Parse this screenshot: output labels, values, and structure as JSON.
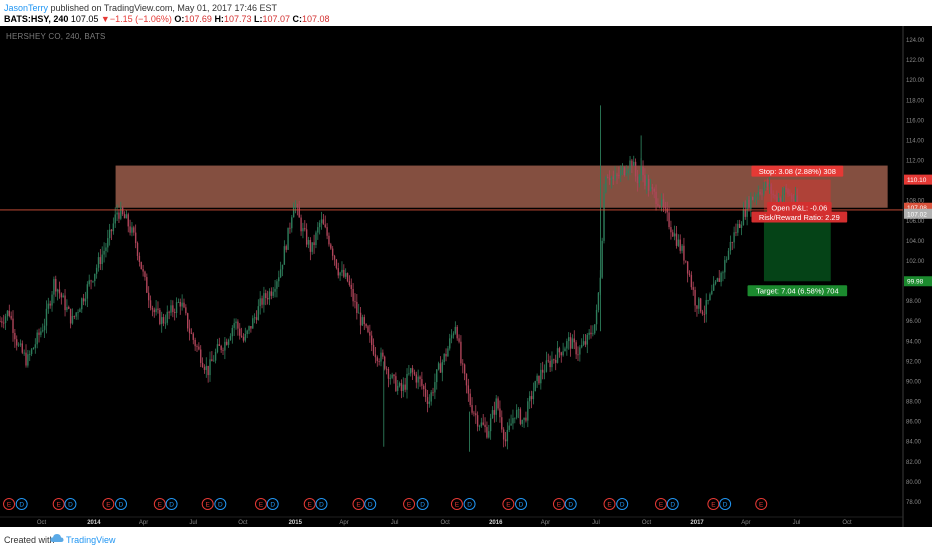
{
  "header": {
    "author": "JasonTerry",
    "published_text": " published on TradingView.com, May 01, 2017 17:46 EST",
    "symbol": "BATS:HSY, 240",
    "last": "107.05",
    "change": "▼−1.15 (−1.06%)",
    "open_label": "O:",
    "open": "107.69",
    "high_label": "H:",
    "high": "107.73",
    "low_label": "L:",
    "low": "107.07",
    "close_label": "C:",
    "close": "107.08"
  },
  "footer": {
    "created_with": "Created with",
    "brand": "TradingView"
  },
  "colors": {
    "background": "#000000",
    "up_candle": "#2e7d5b",
    "down_candle": "#b0455a",
    "resistance_zone": "#b06a55",
    "stop_zone": "#ff2b2b",
    "target_zone": "#0a7a2a",
    "earnings": "#e53935",
    "dividend": "#2196f3"
  },
  "chart_data": {
    "type": "candlestick",
    "title": "HERSHEY CO, 240, BATS",
    "y_ticks": [
      "124.00",
      "122.00",
      "120.00",
      "118.00",
      "116.00",
      "114.00",
      "112.00",
      "110.00",
      "108.00",
      "106.00",
      "104.00",
      "102.00",
      "100.00",
      "98.00",
      "96.00",
      "94.00",
      "92.00",
      "90.00",
      "88.00",
      "86.00",
      "84.00",
      "82.00",
      "80.00",
      "78.00"
    ],
    "ylim": [
      77,
      125
    ],
    "x_ticks": [
      {
        "label": "Oct",
        "pos": 0.046
      },
      {
        "label": "2014",
        "pos": 0.104,
        "bold": true
      },
      {
        "label": "Apr",
        "pos": 0.159
      },
      {
        "label": "Jul",
        "pos": 0.214
      },
      {
        "label": "Oct",
        "pos": 0.269
      },
      {
        "label": "2015",
        "pos": 0.327,
        "bold": true
      },
      {
        "label": "Apr",
        "pos": 0.381
      },
      {
        "label": "Jul",
        "pos": 0.437
      },
      {
        "label": "Oct",
        "pos": 0.493
      },
      {
        "label": "2016",
        "pos": 0.549,
        "bold": true
      },
      {
        "label": "Apr",
        "pos": 0.604
      },
      {
        "label": "Jul",
        "pos": 0.66
      },
      {
        "label": "Oct",
        "pos": 0.716
      },
      {
        "label": "2017",
        "pos": 0.772,
        "bold": true
      },
      {
        "label": "Apr",
        "pos": 0.826
      },
      {
        "label": "Jul",
        "pos": 0.882
      },
      {
        "label": "Oct",
        "pos": 0.938
      }
    ],
    "price_path": [
      [
        0,
        96
      ],
      [
        0.01,
        97
      ],
      [
        0.02,
        93.5
      ],
      [
        0.03,
        92
      ],
      [
        0.04,
        94
      ],
      [
        0.05,
        96
      ],
      [
        0.06,
        100
      ],
      [
        0.07,
        98
      ],
      [
        0.08,
        96
      ],
      [
        0.09,
        98
      ],
      [
        0.1,
        100
      ],
      [
        0.11,
        102
      ],
      [
        0.12,
        104
      ],
      [
        0.13,
        107
      ],
      [
        0.14,
        106
      ],
      [
        0.15,
        104
      ],
      [
        0.16,
        100
      ],
      [
        0.17,
        97
      ],
      [
        0.18,
        96
      ],
      [
        0.19,
        97
      ],
      [
        0.2,
        98
      ],
      [
        0.21,
        95
      ],
      [
        0.22,
        93
      ],
      [
        0.23,
        91
      ],
      [
        0.24,
        93
      ],
      [
        0.25,
        94
      ],
      [
        0.26,
        96
      ],
      [
        0.27,
        94
      ],
      [
        0.28,
        96
      ],
      [
        0.29,
        98
      ],
      [
        0.3,
        99
      ],
      [
        0.31,
        101
      ],
      [
        0.32,
        105
      ],
      [
        0.325,
        108
      ],
      [
        0.335,
        105
      ],
      [
        0.345,
        103
      ],
      [
        0.355,
        106
      ],
      [
        0.365,
        104
      ],
      [
        0.375,
        101
      ],
      [
        0.385,
        100
      ],
      [
        0.395,
        97
      ],
      [
        0.405,
        95
      ],
      [
        0.415,
        93
      ],
      [
        0.425,
        92
      ],
      [
        0.435,
        90
      ],
      [
        0.445,
        89
      ],
      [
        0.455,
        91
      ],
      [
        0.465,
        90
      ],
      [
        0.475,
        88
      ],
      [
        0.485,
        91
      ],
      [
        0.495,
        93
      ],
      [
        0.505,
        96
      ],
      [
        0.51,
        92
      ],
      [
        0.52,
        88
      ],
      [
        0.53,
        86
      ],
      [
        0.54,
        85
      ],
      [
        0.55,
        88
      ],
      [
        0.56,
        84
      ],
      [
        0.57,
        87
      ],
      [
        0.58,
        86
      ],
      [
        0.59,
        89
      ],
      [
        0.6,
        91
      ],
      [
        0.61,
        92
      ],
      [
        0.62,
        93
      ],
      [
        0.63,
        94
      ],
      [
        0.64,
        93
      ],
      [
        0.65,
        94
      ],
      [
        0.66,
        96
      ],
      [
        0.665,
        101
      ],
      [
        0.67,
        111
      ],
      [
        0.68,
        110
      ],
      [
        0.69,
        111
      ],
      [
        0.7,
        112
      ],
      [
        0.705,
        110
      ],
      [
        0.71,
        111
      ],
      [
        0.72,
        109
      ],
      [
        0.73,
        108
      ],
      [
        0.74,
        106
      ],
      [
        0.75,
        104
      ],
      [
        0.76,
        102
      ],
      [
        0.77,
        98
      ],
      [
        0.78,
        97
      ],
      [
        0.79,
        99
      ],
      [
        0.8,
        101
      ],
      [
        0.81,
        104
      ],
      [
        0.82,
        106
      ],
      [
        0.83,
        108
      ],
      [
        0.84,
        109
      ],
      [
        0.85,
        109.5
      ],
      [
        0.86,
        108
      ],
      [
        0.87,
        109
      ],
      [
        0.88,
        108
      ],
      [
        0.885,
        107.1
      ]
    ],
    "resistance_zone": {
      "price_top": 111.5,
      "price_bottom": 107.3,
      "x_start": 0.128,
      "x_end": 0.983
    },
    "price_line": 107.08,
    "position": {
      "entry": 107.02,
      "stop": 110.1,
      "target": 99.98,
      "x_start": 0.846,
      "x_end": 0.92,
      "stop_label": "Stop: 3.08 (2.88%) 308",
      "pnl_label": "Open P&L: -0.06",
      "rr_label": "Risk/Reward Ratio: 2.29",
      "target_label": "Target: 7.04 (6.58%) 704"
    },
    "price_tags": [
      {
        "text": "110.10",
        "price": 110.1,
        "color": "#e53935"
      },
      {
        "text": "107.08",
        "price": 107.3,
        "color": "#d9533c"
      },
      {
        "text": "107.02",
        "price": 106.7,
        "color": "#b0b0b0"
      },
      {
        "text": "99.98",
        "price": 99.98,
        "color": "#1b8a2e"
      }
    ],
    "event_markers": [
      {
        "type": "E",
        "pos": 0.01
      },
      {
        "type": "D",
        "pos": 0.024
      },
      {
        "type": "E",
        "pos": 0.065
      },
      {
        "type": "D",
        "pos": 0.078
      },
      {
        "type": "E",
        "pos": 0.12
      },
      {
        "type": "D",
        "pos": 0.134
      },
      {
        "type": "E",
        "pos": 0.177
      },
      {
        "type": "D",
        "pos": 0.19
      },
      {
        "type": "E",
        "pos": 0.23
      },
      {
        "type": "D",
        "pos": 0.244
      },
      {
        "type": "E",
        "pos": 0.289
      },
      {
        "type": "D",
        "pos": 0.302
      },
      {
        "type": "E",
        "pos": 0.343
      },
      {
        "type": "D",
        "pos": 0.356
      },
      {
        "type": "E",
        "pos": 0.397
      },
      {
        "type": "D",
        "pos": 0.41
      },
      {
        "type": "E",
        "pos": 0.453
      },
      {
        "type": "D",
        "pos": 0.468
      },
      {
        "type": "E",
        "pos": 0.506
      },
      {
        "type": "D",
        "pos": 0.52
      },
      {
        "type": "E",
        "pos": 0.563
      },
      {
        "type": "D",
        "pos": 0.577
      },
      {
        "type": "E",
        "pos": 0.619
      },
      {
        "type": "D",
        "pos": 0.632
      },
      {
        "type": "E",
        "pos": 0.675
      },
      {
        "type": "D",
        "pos": 0.689
      },
      {
        "type": "E",
        "pos": 0.732
      },
      {
        "type": "D",
        "pos": 0.745
      },
      {
        "type": "E",
        "pos": 0.79
      },
      {
        "type": "D",
        "pos": 0.803
      },
      {
        "type": "E",
        "pos": 0.843
      }
    ]
  }
}
